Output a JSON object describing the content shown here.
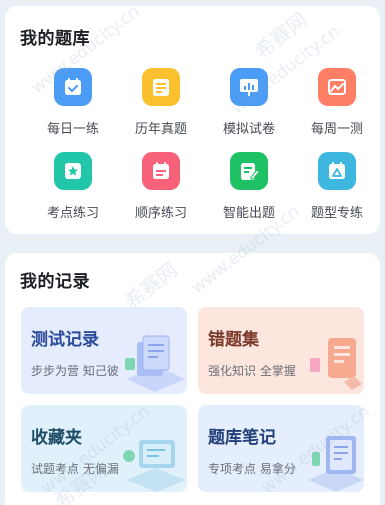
{
  "question_bank": {
    "title": "我的题库",
    "items": [
      {
        "label": "每日一练",
        "icon": "calendar-check-icon",
        "color": "#4b9cf5"
      },
      {
        "label": "历年真题",
        "icon": "document-list-icon",
        "color": "#fbc02d"
      },
      {
        "label": "模拟试卷",
        "icon": "presentation-board-icon",
        "color": "#4b9cf5"
      },
      {
        "label": "每周一测",
        "icon": "image-chart-icon",
        "color": "#ff7f66"
      },
      {
        "label": "考点练习",
        "icon": "star-badge-icon",
        "color": "#21c7a8"
      },
      {
        "label": "顺序练习",
        "icon": "calendar-list-icon",
        "color": "#f7617a"
      },
      {
        "label": "智能出题",
        "icon": "edit-document-icon",
        "color": "#1fc165"
      },
      {
        "label": "题型专练",
        "icon": "triangle-calendar-icon",
        "color": "#3db7e0"
      }
    ]
  },
  "records": {
    "title": "我的记录",
    "tiles": [
      {
        "title": "测试记录",
        "subtitle": "步步为营 知己彼",
        "bg": "#e4ecfd",
        "title_color": "#2a4a9a"
      },
      {
        "title": "错题集",
        "subtitle": "强化知识 全掌握",
        "bg": "#fde6de",
        "title_color": "#7a3a2a"
      },
      {
        "title": "收藏夹",
        "subtitle": "试题考点 无偏漏",
        "bg": "#e0f1fb",
        "title_color": "#1d4d66"
      },
      {
        "title": "题库笔记",
        "subtitle": "专项考点 易拿分",
        "bg": "#e5eefc",
        "title_color": "#23407a"
      }
    ]
  },
  "watermark": {
    "text": "www.educity.cn",
    "brand": "希赛网"
  }
}
